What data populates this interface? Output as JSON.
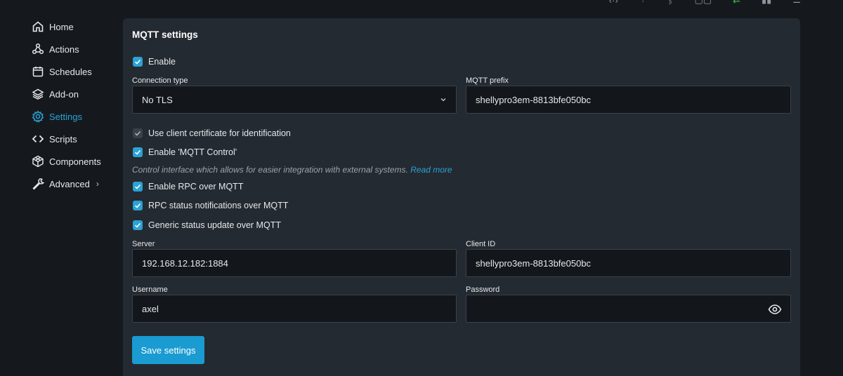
{
  "sidebar": {
    "items": [
      {
        "label": "Home",
        "icon": "home-icon"
      },
      {
        "label": "Actions",
        "icon": "actions-icon"
      },
      {
        "label": "Schedules",
        "icon": "calendar-icon"
      },
      {
        "label": "Add-on",
        "icon": "layers-icon"
      },
      {
        "label": "Settings",
        "icon": "gear-icon",
        "active": true
      },
      {
        "label": "Scripts",
        "icon": "code-icon"
      },
      {
        "label": "Components",
        "icon": "components-icon"
      },
      {
        "label": "Advanced",
        "icon": "wrench-icon"
      }
    ]
  },
  "mqtt": {
    "title": "MQTT settings",
    "enable_label": "Enable",
    "connection_type_label": "Connection type",
    "connection_type_value": "No TLS",
    "prefix_label": "MQTT prefix",
    "prefix_value": "shellypro3em-8813bfe050bc",
    "client_cert_label": "Use client certificate for identification",
    "mqtt_control_label": "Enable 'MQTT Control'",
    "hint_text": "Control interface which allows for easier integration with external systems.",
    "hint_link": "Read more",
    "rpc_label": "Enable RPC over MQTT",
    "rpc_status_label": "RPC status notifications over MQTT",
    "generic_status_label": "Generic status update over MQTT",
    "server_label": "Server",
    "server_value": "192.168.12.182:1884",
    "client_id_label": "Client ID",
    "client_id_value": "shellypro3em-8813bfe050bc",
    "username_label": "Username",
    "username_value": "axel",
    "password_label": "Password",
    "password_value": "",
    "save_label": "Save settings"
  },
  "colors": {
    "accent": "#2aa3d6",
    "background": "#15191e",
    "card": "#242a31"
  }
}
